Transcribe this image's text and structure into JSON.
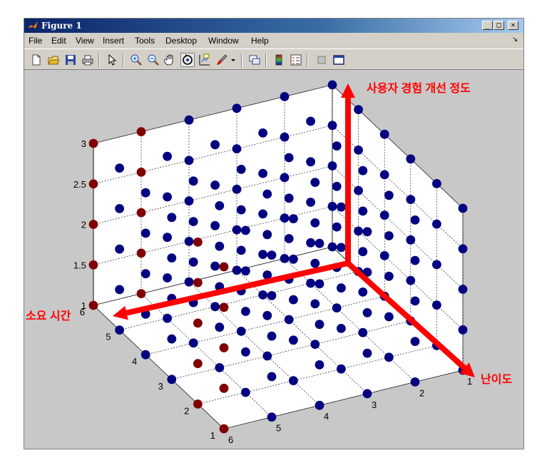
{
  "window": {
    "title": "Figure 1",
    "minimize_glyph": "_",
    "maximize_glyph": "□",
    "close_glyph": "×"
  },
  "menu": [
    "File",
    "Edit",
    "View",
    "Insert",
    "Tools",
    "Desktop",
    "Window",
    "Help"
  ],
  "menu_corner_glyph": "↘",
  "toolbar_icons": [
    "new-figure-icon",
    "open-file-icon",
    "save-icon",
    "print-icon",
    "pointer-icon",
    "zoom-in-icon",
    "zoom-out-icon",
    "pan-hand-icon",
    "rotate-3d-icon",
    "data-cursor-icon",
    "brush-icon",
    "dropdown-arrow-icon",
    "link-plot-icon",
    "colorbar-icon",
    "legend-icon",
    "hide-plot-tools-icon",
    "show-plot-tools-icon"
  ],
  "annotations": {
    "up": "사용자 경험 개선 정도",
    "left": "소요 시간",
    "right": "난이도",
    "color": "#ff0000"
  },
  "chart_data": {
    "type": "scatter",
    "projection": "3d",
    "axes": {
      "x": {
        "name": "난이도",
        "ticks": [
          6,
          5,
          4,
          3,
          2,
          1
        ],
        "range": [
          1,
          6
        ]
      },
      "y": {
        "name": "소요 시간",
        "ticks": [
          1,
          2,
          3,
          4,
          5,
          6
        ],
        "range": [
          1,
          6
        ]
      },
      "z": {
        "name": "사용자 경험 개선 정도",
        "ticks": [
          "1",
          "1.5",
          "2",
          "2.5",
          "3"
        ],
        "range": [
          1,
          3
        ]
      }
    },
    "grid": true,
    "series": [
      {
        "color": "#000080",
        "points": "x,y ∈ {1..6}, z ∈ {1, 1.5, 2, 2.5, 3} except highlighted"
      },
      {
        "color": "#800000",
        "points": "x = 1 with y ≤ 2 at every z; y = 6 with x ≤ 2 at every z (two highlighted edges)"
      }
    ],
    "point_colors": {
      "default": "#000080",
      "highlight": "#800000"
    }
  }
}
